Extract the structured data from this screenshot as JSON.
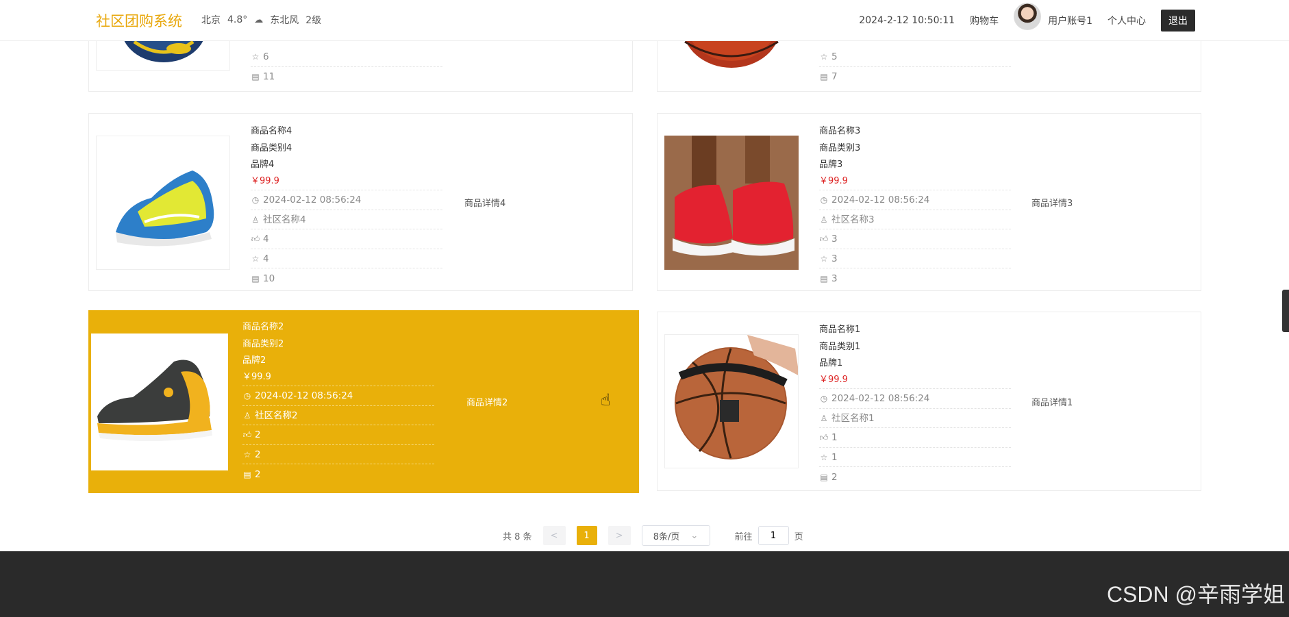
{
  "header": {
    "brand": "社区团购系统",
    "city": "北京",
    "temp": "4.8°",
    "wind": "东北风",
    "wind_level": "2级",
    "time": "2024-2-12 10:50:11",
    "cart": "购物车",
    "username": "用户账号1",
    "profile": "个人中心",
    "logout": "退出"
  },
  "top_cards": [
    {
      "favorites": "6",
      "comments": "11"
    },
    {
      "favorites": "5",
      "comments": "7"
    }
  ],
  "products": [
    {
      "name": "商品名称4",
      "category": "商品类别4",
      "brand": "品牌4",
      "price": "￥99.9",
      "date": "2024-02-12 08:56:24",
      "community": "社区名称4",
      "likes": "4",
      "favorites": "4",
      "comments": "10",
      "detail": "商品详情4",
      "image": "blue-yellow-sneaker"
    },
    {
      "name": "商品名称3",
      "category": "商品类别3",
      "brand": "品牌3",
      "price": "￥99.9",
      "date": "2024-02-12 08:56:24",
      "community": "社区名称3",
      "likes": "3",
      "favorites": "3",
      "comments": "3",
      "detail": "商品详情3",
      "image": "red-sneaker"
    },
    {
      "name": "商品名称2",
      "category": "商品类别2",
      "brand": "品牌2",
      "price": "￥99.9",
      "date": "2024-02-12 08:56:24",
      "community": "社区名称2",
      "likes": "2",
      "favorites": "2",
      "comments": "2",
      "detail": "商品详情2",
      "image": "black-yellow-sneaker"
    },
    {
      "name": "商品名称1",
      "category": "商品类别1",
      "brand": "品牌1",
      "price": "￥99.9",
      "date": "2024-02-12 08:56:24",
      "community": "社区名称1",
      "likes": "1",
      "favorites": "1",
      "comments": "2",
      "detail": "商品详情1",
      "image": "basketball"
    }
  ],
  "pagination": {
    "total": "共 8 条",
    "prev": "<",
    "page": "1",
    "next": ">",
    "page_size": "8条/页",
    "goto_label": "前往",
    "goto_value": "1",
    "goto_unit": "页"
  },
  "watermark": "CSDN @辛雨学姐",
  "colors": {
    "accent": "#e9b00a",
    "price": "#dd2222",
    "footer": "#2a2a2a"
  }
}
